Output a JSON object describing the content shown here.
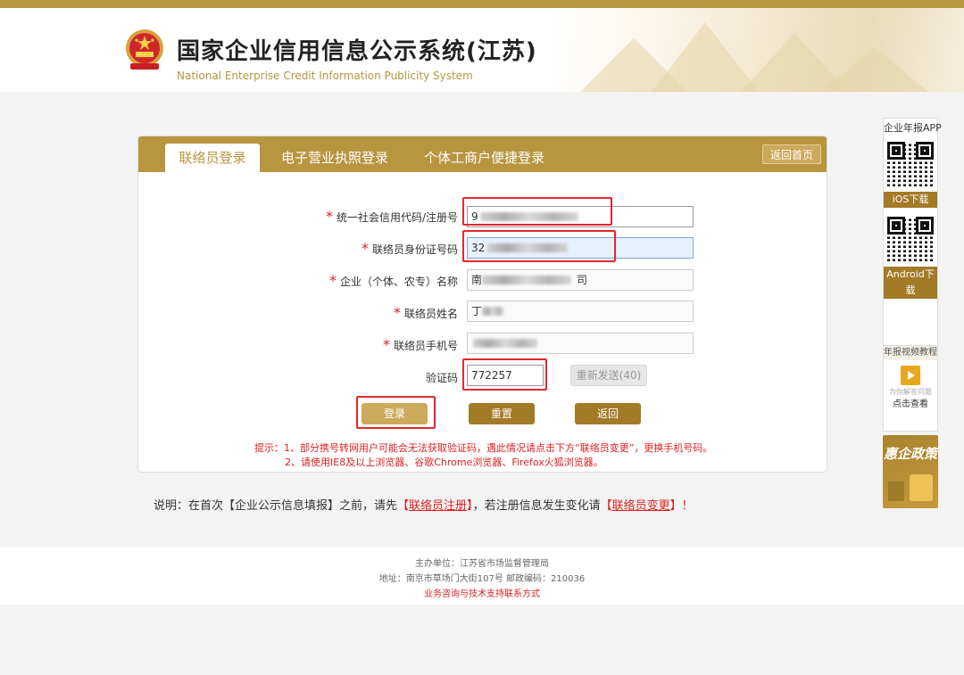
{
  "header": {
    "title": "国家企业信用信息公示系统(江苏)",
    "subtitle": "National Enterprise Credit Information Publicity System"
  },
  "tabs": [
    {
      "label": "联络员登录",
      "active": true
    },
    {
      "label": "电子营业执照登录",
      "active": false
    },
    {
      "label": "个体工商户便捷登录",
      "active": false
    }
  ],
  "home_button": "返回首页",
  "form": {
    "credit_code_label": "统一社会信用代码/注册号",
    "credit_code_value": "9",
    "id_label": "联络员身份证号码",
    "id_value": "32",
    "company_label": "企业（个体、农专）名称",
    "company_value_start": "南",
    "company_value_end": "司",
    "name_label": "联络员姓名",
    "name_value": "丁",
    "phone_label": "联络员手机号",
    "phone_value": "",
    "captcha_label": "验证码",
    "captcha_value": "772257",
    "resend_label": "重新发送(40)",
    "required_mark": "*"
  },
  "buttons": {
    "login": "登录",
    "reset": "重置",
    "back": "返回"
  },
  "tips": {
    "line1": "提示：1、部分携号转网用户可能会无法获取验证码，遇此情况请点击下方“联络员变更”，更换手机号码。",
    "line2": "2、请使用IE8及以上浏览器、谷歌Chrome浏览器、Firefox火狐浏览器。"
  },
  "note": {
    "prefix": "说明：在首次【企业公示信息填报】之前，请先",
    "link1": "联络员注册",
    "middle": "，若注册信息发生变化请",
    "link2": "联络员变更",
    "suffix": "！",
    "bracket_open": "【",
    "bracket_close": "】"
  },
  "footer": {
    "host": "主办单位：江苏省市场监督管理局",
    "address": "地址：南京市草场门大街107号   邮政编码：210036",
    "contact": "业务咨询与技术支持联系方式"
  },
  "sidebar": {
    "app_title": "企业年报APP",
    "ios": "iOS下载",
    "android": "Android下载",
    "video_title": "年报视频教程",
    "video_sub": "为你解答问题",
    "video_link": "点击查看",
    "policy": "惠企政策"
  },
  "colors": {
    "brand_gold": "#b8953f",
    "button_dark": "#a37a26",
    "alert_red": "#e02020"
  }
}
